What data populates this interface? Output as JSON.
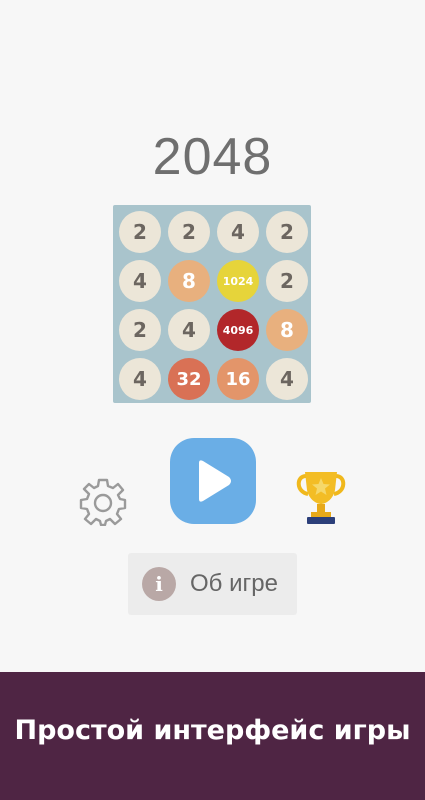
{
  "game_title": "2048",
  "board": {
    "rows": [
      [
        "2",
        "2",
        "4",
        "2"
      ],
      [
        "4",
        "8",
        "1024",
        "2"
      ],
      [
        "2",
        "4",
        "4096",
        "8"
      ],
      [
        "4",
        "32",
        "16",
        "4"
      ]
    ],
    "tile_styles": {
      "2": {
        "bg": "#ece6d8",
        "fg": "#6c6660"
      },
      "4": {
        "bg": "#ece6d8",
        "fg": "#6c6660"
      },
      "8": {
        "bg": "#e8b07e",
        "fg": "#ffffff"
      },
      "16": {
        "bg": "#e3956a",
        "fg": "#ffffff"
      },
      "32": {
        "bg": "#d97155",
        "fg": "#ffffff"
      },
      "1024": {
        "bg": "#e6d43a",
        "fg": "#ffffff"
      },
      "4096": {
        "bg": "#b2272a",
        "fg": "#ffffff"
      }
    }
  },
  "controls": {
    "settings_icon": "gear-icon",
    "play_icon": "play-icon",
    "leaderboard_icon": "trophy-icon"
  },
  "about": {
    "icon_glyph": "i",
    "label": "Об игре"
  },
  "banner": {
    "caption": "Простой интерфейс игры"
  },
  "colors": {
    "background": "#f7f7f7",
    "board": "#a9c4cc",
    "play_button": "#6aaee6",
    "banner": "#4f2544"
  }
}
